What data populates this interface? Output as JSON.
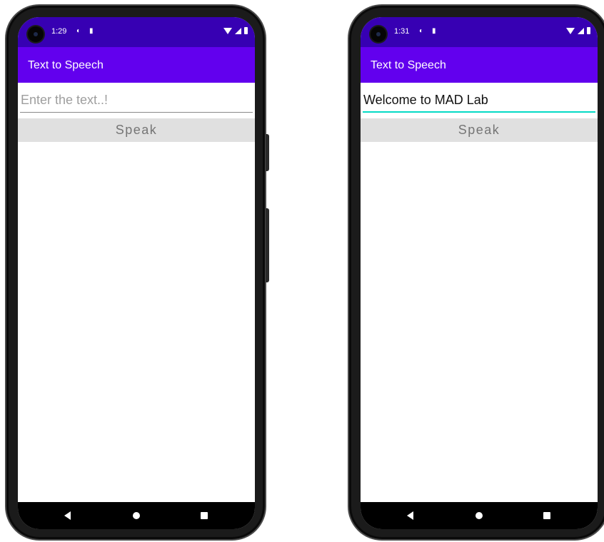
{
  "colors": {
    "status_bar": "#3700b3",
    "app_bar": "#6200ee",
    "accent": "#03dac5",
    "button_bg": "#e0e0e0"
  },
  "left_phone": {
    "status": {
      "time": "1:29"
    },
    "app_bar": {
      "title": "Text to Speech"
    },
    "text_field": {
      "value": "",
      "placeholder": "Enter the text..!"
    },
    "speak_button": {
      "label": "Speak"
    }
  },
  "right_phone": {
    "status": {
      "time": "1:31"
    },
    "app_bar": {
      "title": "Text to Speech"
    },
    "text_field": {
      "value": "Welcome to MAD Lab",
      "placeholder": "Enter the text..!"
    },
    "speak_button": {
      "label": "Speak"
    }
  },
  "icons": {
    "status": [
      "camera-icon",
      "dnd-icon",
      "sd-card-icon",
      "wifi-icon",
      "signal-icon",
      "battery-icon"
    ],
    "nav": [
      "back-icon",
      "home-icon",
      "recents-icon"
    ]
  }
}
